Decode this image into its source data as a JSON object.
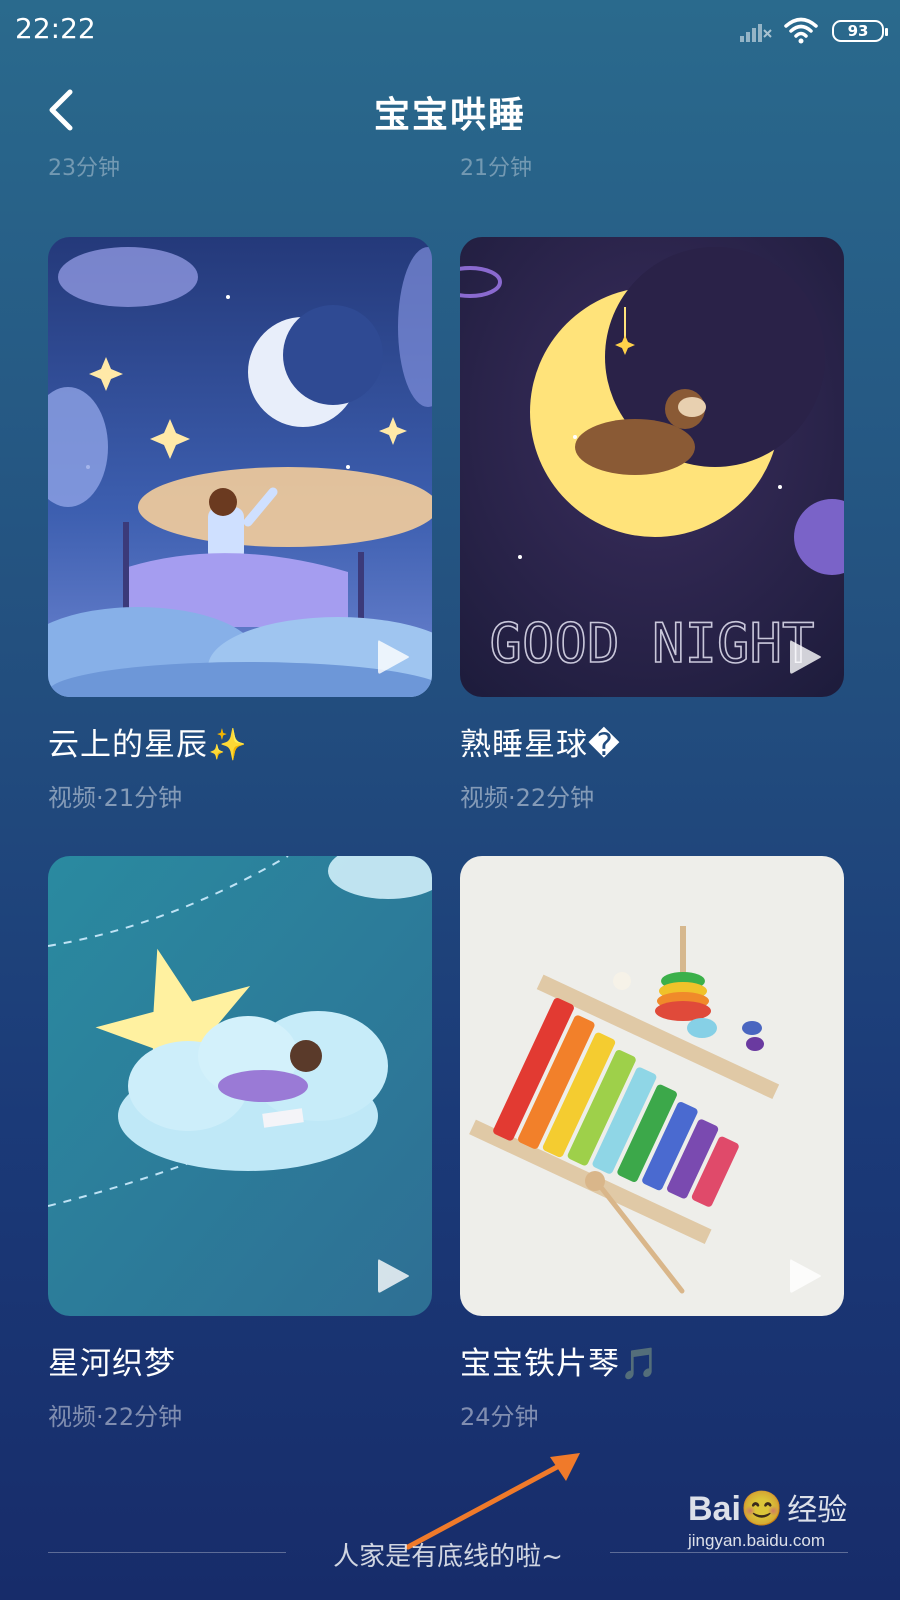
{
  "status_bar": {
    "time": "22:22",
    "battery": "93"
  },
  "header": {
    "title": "宝宝哄睡"
  },
  "previous_row": {
    "left_sub": "23分钟",
    "right_sub": "21分钟"
  },
  "cards": [
    {
      "title": "云上的星辰✨",
      "subtitle": "视频·21分钟",
      "image": "child-on-cloud-bed-moon-illustration"
    },
    {
      "title": "熟睡星球�",
      "subtitle": "视频·22分钟",
      "image": "bear-sleeping-on-moon-good-night-illustration",
      "image_text": "GOOD NIGHT"
    },
    {
      "title": "星河织梦",
      "subtitle": "视频·22分钟",
      "image": "girl-reading-on-cloud-star-illustration"
    },
    {
      "title": "宝宝铁片琴🎵",
      "subtitle": "24分钟",
      "image": "rainbow-xylophone-photo"
    }
  ],
  "footer": {
    "text": "人家是有底线的啦~"
  },
  "watermark": {
    "logo": "Bai😊",
    "cn": "经验",
    "url": "jingyan.baidu.com"
  },
  "colors": {
    "bg_top": "#2a6a8d",
    "bg_bottom": "#172c6a",
    "text": "#ffffff"
  }
}
